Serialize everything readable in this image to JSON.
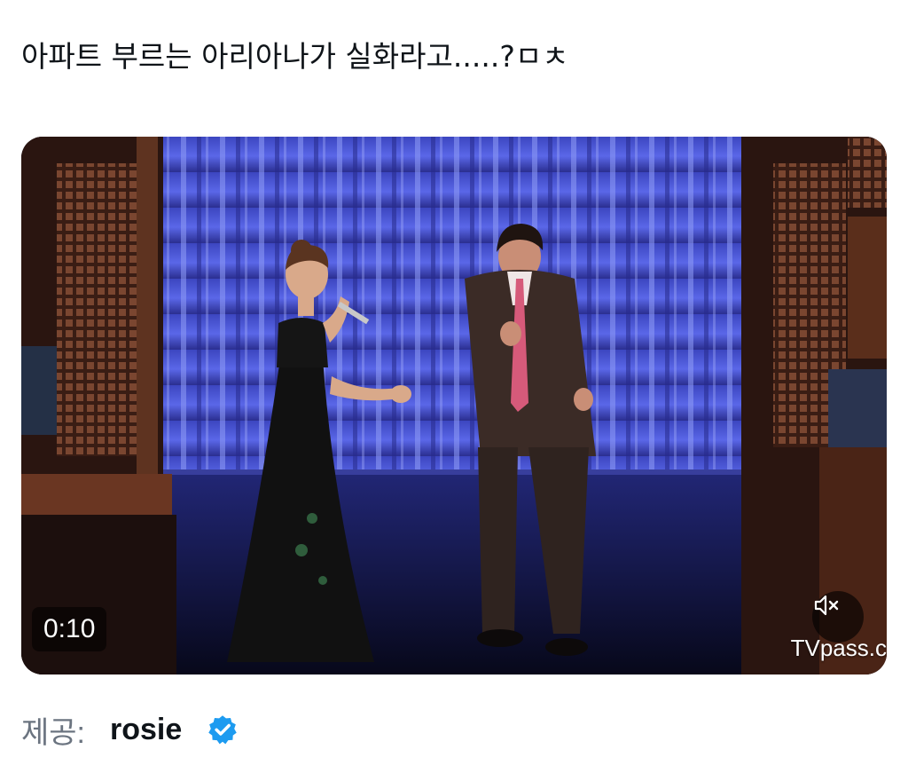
{
  "post": {
    "text": "아파트 부르는 아리아나가 실화라고.....?ㅁㅊ"
  },
  "video": {
    "timestamp": "0:10",
    "watermark": "TVpass.c",
    "mute_icon": "speaker-muted-icon",
    "colors": {
      "curtain": "#4a57d8",
      "floor": "#0d0f2a"
    }
  },
  "credit": {
    "label": "제공:",
    "name": "rosie",
    "badge_icon": "verified-badge-icon",
    "badge_color": "#1d9bf0"
  }
}
